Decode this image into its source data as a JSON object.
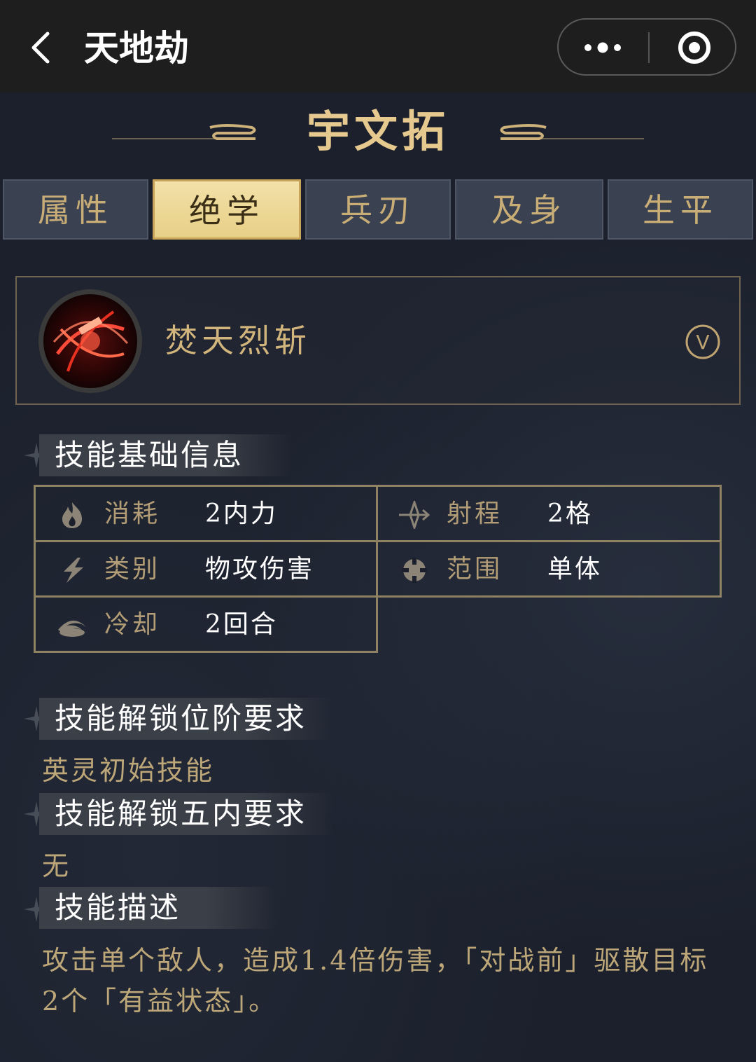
{
  "topbar": {
    "title": "天地劫",
    "back_icon": "chevron-left-icon",
    "more_icon": "more-dots-icon",
    "close_icon": "target-circle-icon"
  },
  "hero": {
    "name": "宇文拓"
  },
  "tabs": [
    {
      "label": "属性",
      "active": false
    },
    {
      "label": "绝学",
      "active": true
    },
    {
      "label": "兵刃",
      "active": false
    },
    {
      "label": "及身",
      "active": false
    },
    {
      "label": "生平",
      "active": false
    }
  ],
  "skill": {
    "name": "焚天烈斩",
    "expand_label": "V"
  },
  "sections": {
    "basic_info": "技能基础信息",
    "unlock_rank": "技能解锁位阶要求",
    "unlock_rank_value": "英灵初始技能",
    "unlock_five": "技能解锁五内要求",
    "unlock_five_value": "无",
    "description_title": "技能描述",
    "description": "攻击单个敌人，造成1.4倍伤害，「对战前」驱散目标2个「有益状态」。"
  },
  "info": {
    "cost": {
      "label": "消耗",
      "value": "2内力",
      "icon": "flame-icon"
    },
    "range": {
      "label": "射程",
      "value": "2格",
      "icon": "arrow-target-icon"
    },
    "type": {
      "label": "类别",
      "value": "物攻伤害",
      "icon": "lightning-icon"
    },
    "area": {
      "label": "范围",
      "value": "单体",
      "icon": "single-target-icon"
    },
    "cooldown": {
      "label": "冷却",
      "value": "2回合",
      "icon": "cooldown-swirl-icon"
    }
  },
  "colors": {
    "gold": "#e6c98e",
    "label_gold": "#b39d76",
    "border_gold": "#8f8262",
    "bg": "#1b202c"
  }
}
